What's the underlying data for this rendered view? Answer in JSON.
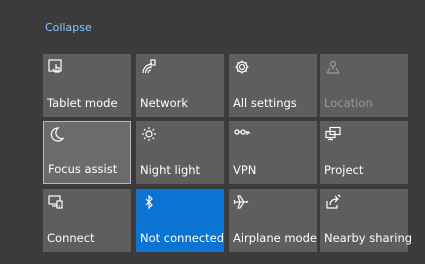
{
  "header": {
    "collapse_label": "Collapse"
  },
  "tiles": [
    {
      "label": "Tablet mode",
      "icon": "tablet-mode-icon",
      "state": "off"
    },
    {
      "label": "Network",
      "icon": "network-icon",
      "state": "off"
    },
    {
      "label": "All settings",
      "icon": "gear-icon",
      "state": "off"
    },
    {
      "label": "Location",
      "icon": "location-icon",
      "state": "disabled"
    },
    {
      "label": "Focus assist",
      "icon": "moon-icon",
      "state": "focused"
    },
    {
      "label": "Night light",
      "icon": "sun-icon",
      "state": "off"
    },
    {
      "label": "VPN",
      "icon": "vpn-icon",
      "state": "off"
    },
    {
      "label": "Project",
      "icon": "project-icon",
      "state": "off"
    },
    {
      "label": "Connect",
      "icon": "connect-icon",
      "state": "off"
    },
    {
      "label": "Not connected",
      "icon": "bluetooth-icon",
      "state": "on"
    },
    {
      "label": "Airplane mode",
      "icon": "airplane-icon",
      "state": "off"
    },
    {
      "label": "Nearby sharing",
      "icon": "nearby-sharing-icon",
      "state": "off"
    }
  ],
  "colors": {
    "background": "#3b3b3b",
    "tile": "#5e5e5e",
    "active_tile": "#0b73d1",
    "link": "#8fc3ff",
    "disabled_text": "#9a9a9a"
  }
}
